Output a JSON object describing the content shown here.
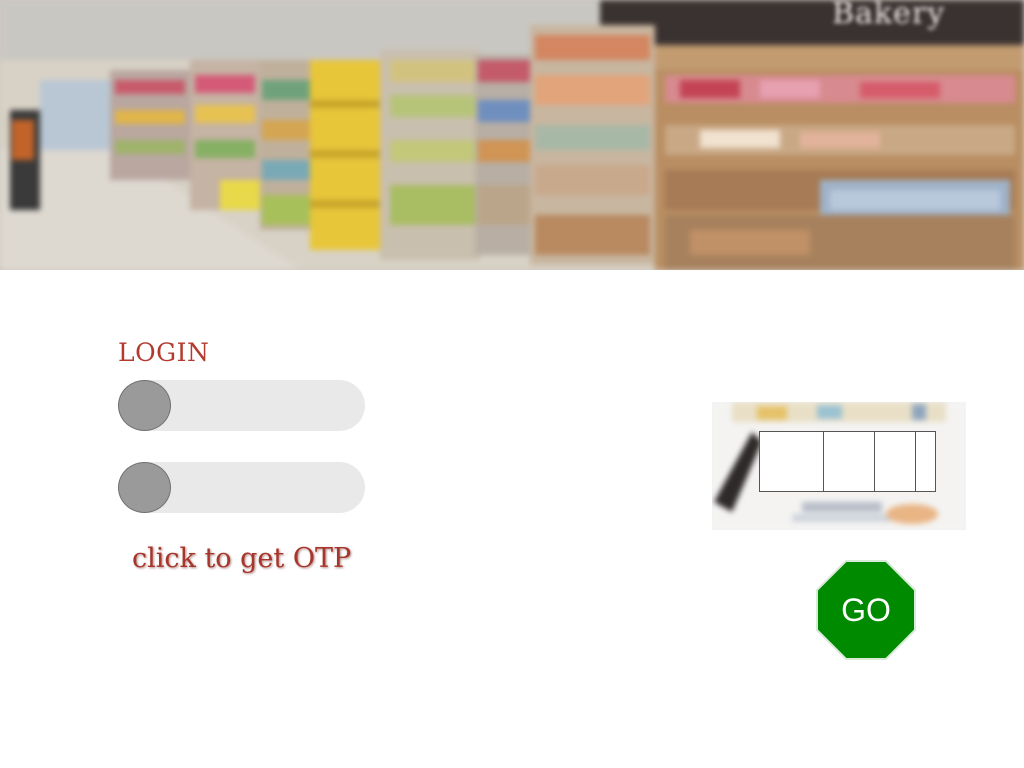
{
  "banner": {
    "image": "blurred-supermarket-aisle-photo",
    "sign_text": "Bakery"
  },
  "login": {
    "title": "LOGIN",
    "username_value": "",
    "password_value": "",
    "otp_link_label": "click to get OTP"
  },
  "captcha": {
    "image": "blurred-captcha-photo",
    "otp_digits": [
      "",
      "",
      "",
      ""
    ]
  },
  "go_button": {
    "label": "GO",
    "color": "#008a00"
  },
  "colors": {
    "login_title": "#b33a2f",
    "otp_link": "#a8352b",
    "field_bg": "#e9e9e9",
    "knob": "#9a9a9a"
  }
}
